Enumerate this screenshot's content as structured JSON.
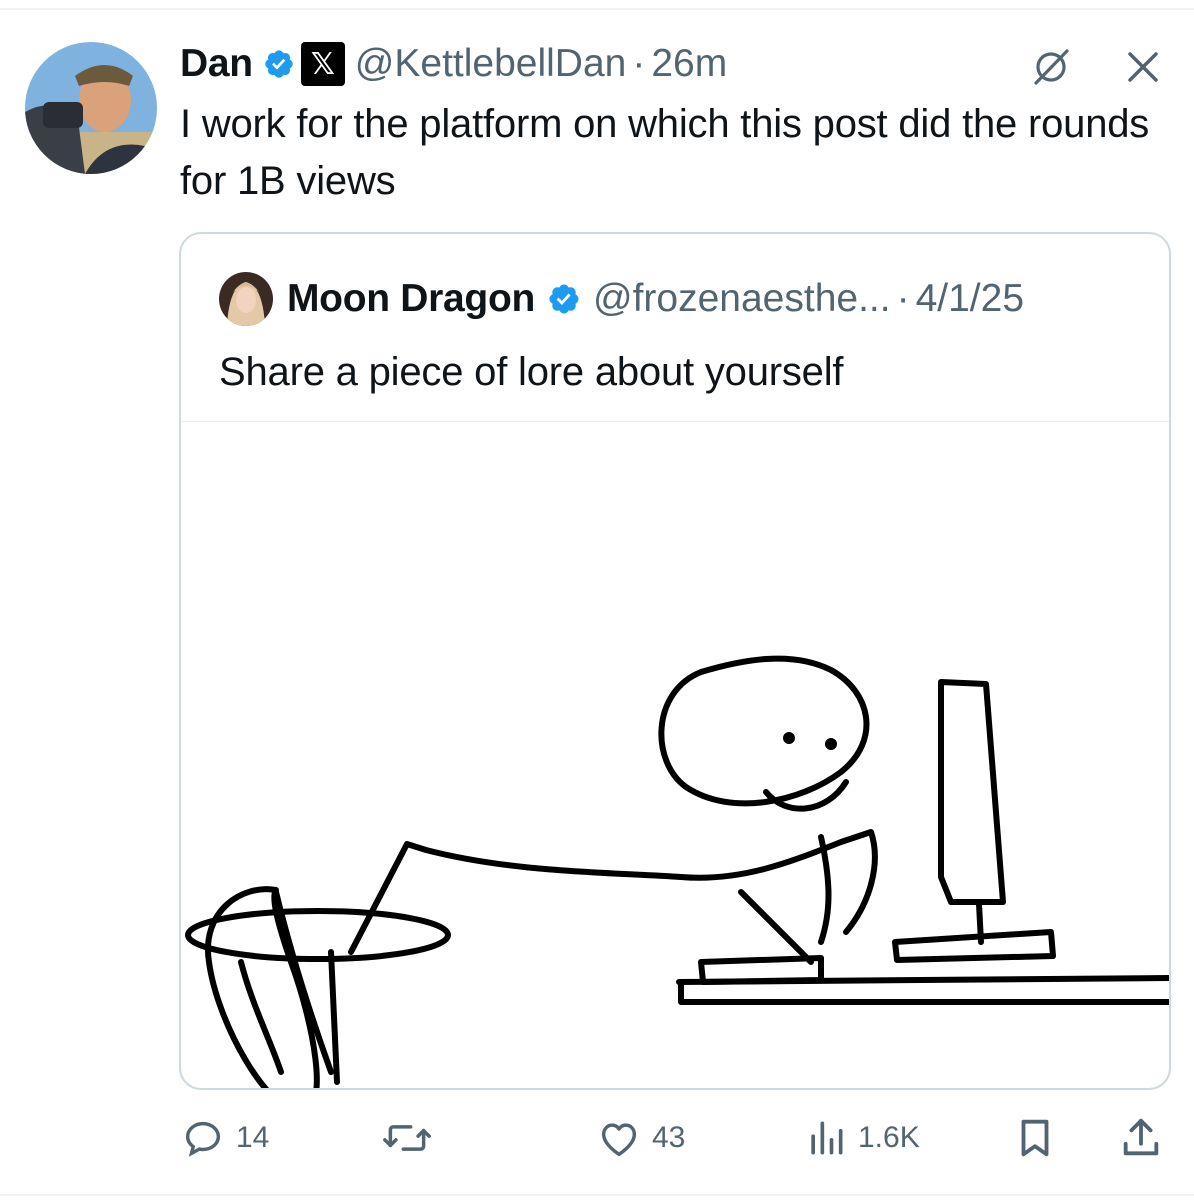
{
  "post": {
    "author_name": "Dan",
    "handle": "@KettlebellDan",
    "separator": "·",
    "time": "26m",
    "text": "I work for the platform on which this post did the rounds for 1B views",
    "x_badge": "𝕏",
    "icons": [
      "verified-badge-icon",
      "x-affiliate-icon",
      "grok-icon",
      "close-icon"
    ]
  },
  "quote": {
    "author_name": "Moon Dragon",
    "handle": "@frozenaesthe...",
    "separator": "·",
    "date": "4/1/25",
    "text": "Share a piece of lore about yourself"
  },
  "actions": {
    "replies": "14",
    "reposts": "",
    "likes": "43",
    "views": "1.6K",
    "icons": [
      "reply-icon",
      "repost-icon",
      "like-icon",
      "views-icon",
      "bookmark-icon",
      "share-icon"
    ]
  },
  "colors": {
    "verified": "#1d9bf0",
    "secondary_text": "#536471",
    "border": "#cfd9de"
  }
}
